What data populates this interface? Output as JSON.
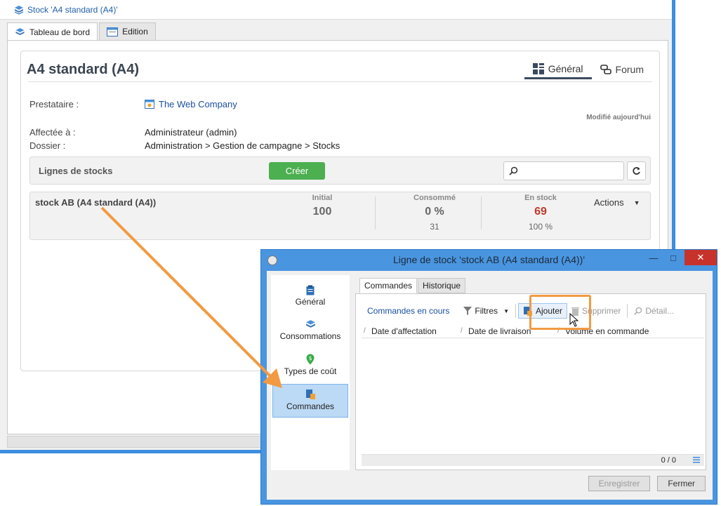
{
  "main_window": {
    "title": "Stock 'A4 standard (A4)'",
    "tabs": [
      {
        "label": "Tableau de bord",
        "active": true
      },
      {
        "label": "Edition",
        "active": false
      }
    ]
  },
  "page": {
    "title": "A4 standard (A4)",
    "view_tabs": [
      {
        "label": "Général",
        "active": true
      },
      {
        "label": "Forum",
        "active": false
      }
    ],
    "fields": {
      "prestataire_label": "Prestataire :",
      "prestataire_value": "The Web Company",
      "modified": "Modifié aujourd'hui",
      "affectee_label": "Affectée à :",
      "affectee_value": "Administrateur (admin)",
      "dossier_label": "Dossier :",
      "dossier_value": "Administration > Gestion de campagne > Stocks"
    }
  },
  "stock_lines": {
    "title": "Lignes de stocks",
    "create_label": "Créer",
    "search_placeholder": "",
    "row": {
      "name": "stock AB (A4 standard (A4))",
      "initial_label": "Initial",
      "initial_value": "100",
      "consumed_label": "Consommé",
      "consumed_value": "0 %",
      "consumed_sub": "31",
      "in_stock_label": "En stock",
      "in_stock_value": "69",
      "in_stock_sub": "100 %",
      "actions_label": "Actions"
    }
  },
  "dialog": {
    "title": "Ligne de stock 'stock AB (A4 standard (A4))'",
    "nav": [
      {
        "label": "Général",
        "icon": "clipboard-icon"
      },
      {
        "label": "Consommations",
        "icon": "box-icon"
      },
      {
        "label": "Types de coût",
        "icon": "money-pin-icon"
      },
      {
        "label": "Commandes",
        "icon": "order-icon",
        "selected": true
      }
    ],
    "inner_tabs": [
      {
        "label": "Commandes",
        "active": true
      },
      {
        "label": "Historique",
        "active": false
      }
    ],
    "toolbar": {
      "filter_view": "Commandes en cours",
      "filters": "Filtres",
      "add": "Ajouter",
      "delete": "Supprimer",
      "detail": "Détail..."
    },
    "columns": [
      "Date d'affectation",
      "Date de livraison",
      "Volume en commande"
    ],
    "footer_count": "0 / 0",
    "buttons": {
      "save": "Enregistrer",
      "close": "Fermer"
    }
  },
  "colors": {
    "accent_blue": "#3c8ee0",
    "create_green": "#4caf50",
    "in_stock_red": "#c0392b",
    "highlight_orange": "#f29a42"
  }
}
